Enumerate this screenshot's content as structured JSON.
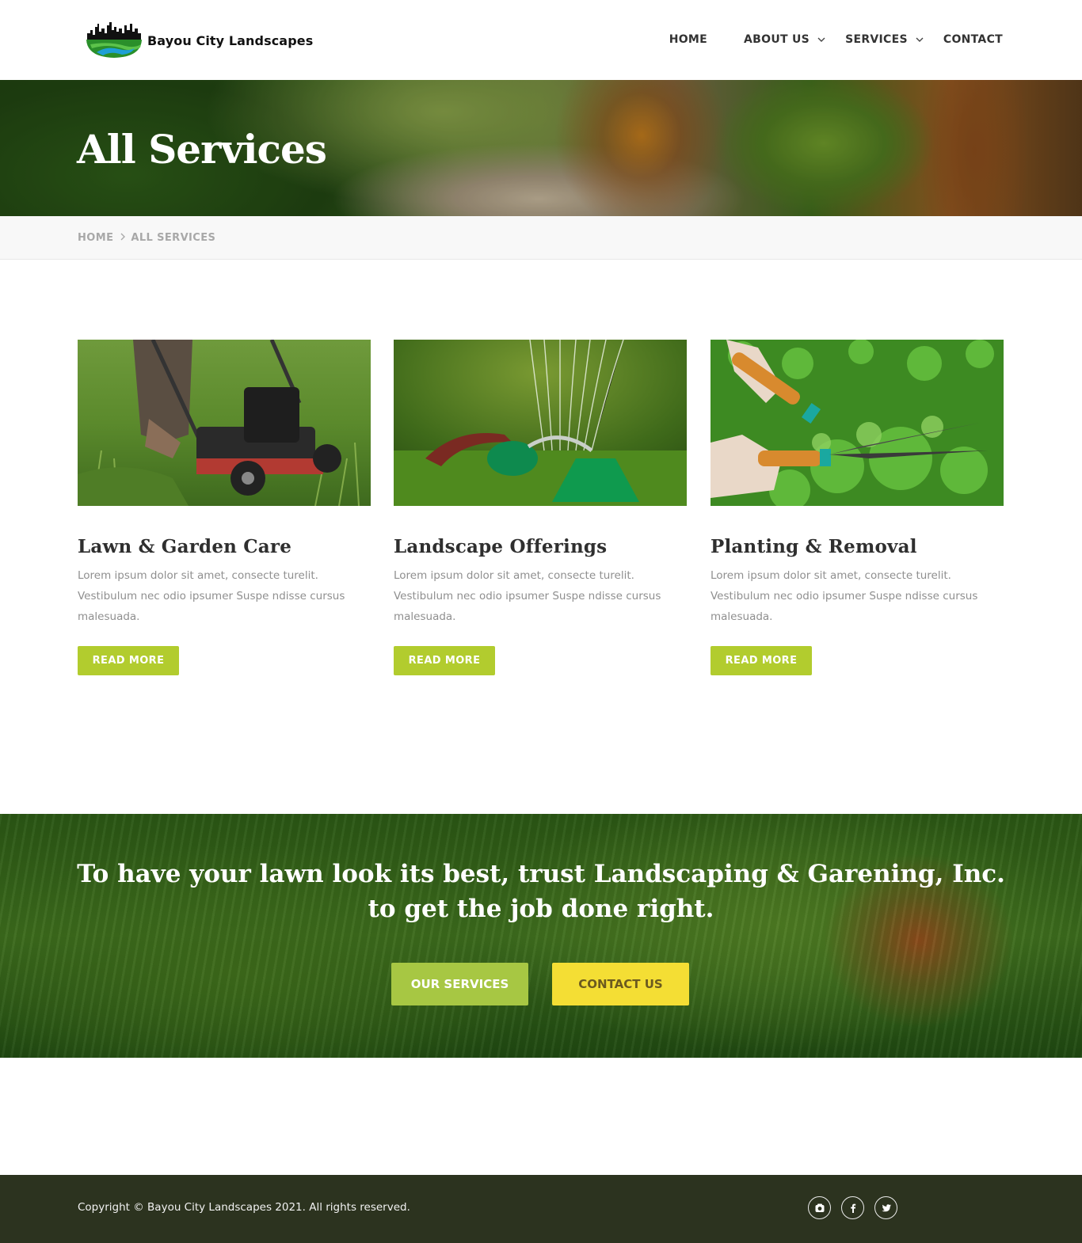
{
  "brand": {
    "name": "Bayou City Landscapes"
  },
  "nav": {
    "items": [
      {
        "label": "HOME",
        "dropdown": false
      },
      {
        "label": "ABOUT US",
        "dropdown": true
      },
      {
        "label": "SERVICES",
        "dropdown": true
      },
      {
        "label": "CONTACT",
        "dropdown": false
      }
    ]
  },
  "hero": {
    "title": "All Services"
  },
  "breadcrumb": {
    "home": "HOME",
    "current": "ALL SERVICES"
  },
  "services": [
    {
      "title": "Lawn & Garden Care",
      "text": "Lorem ipsum dolor sit amet, consecte turelit. Vestibulum nec odio ipsumer Suspe ndisse cursus malesuada.",
      "button": "READ MORE",
      "image_icon": "lawn-mower-photo"
    },
    {
      "title": "Landscape Offerings",
      "text": "Lorem ipsum dolor sit amet, consecte turelit. Vestibulum nec odio ipsumer Suspe ndisse cursus malesuada.",
      "button": "READ MORE",
      "image_icon": "sprinkler-photo"
    },
    {
      "title": "Planting & Removal",
      "text": "Lorem ipsum dolor sit amet, consecte turelit. Vestibulum nec odio ipsumer Suspe ndisse cursus malesuada.",
      "button": "READ MORE",
      "image_icon": "hedge-shears-photo"
    }
  ],
  "cta": {
    "text": "To have your lawn look its best, trust Landscaping & Garening, Inc. to get the job done right.",
    "services_button": "OUR SERVICES",
    "contact_button": "CONTACT US"
  },
  "footer": {
    "copyright": "Copyright © Bayou City Landscapes 2021. All rights reserved.",
    "socials": [
      "instagram-icon",
      "facebook-icon",
      "twitter-icon"
    ]
  },
  "colors": {
    "accent": "#b2cc2e",
    "cta_green": "#a7c743",
    "cta_yellow": "#f4de34",
    "footer_bg": "#2c331f"
  }
}
